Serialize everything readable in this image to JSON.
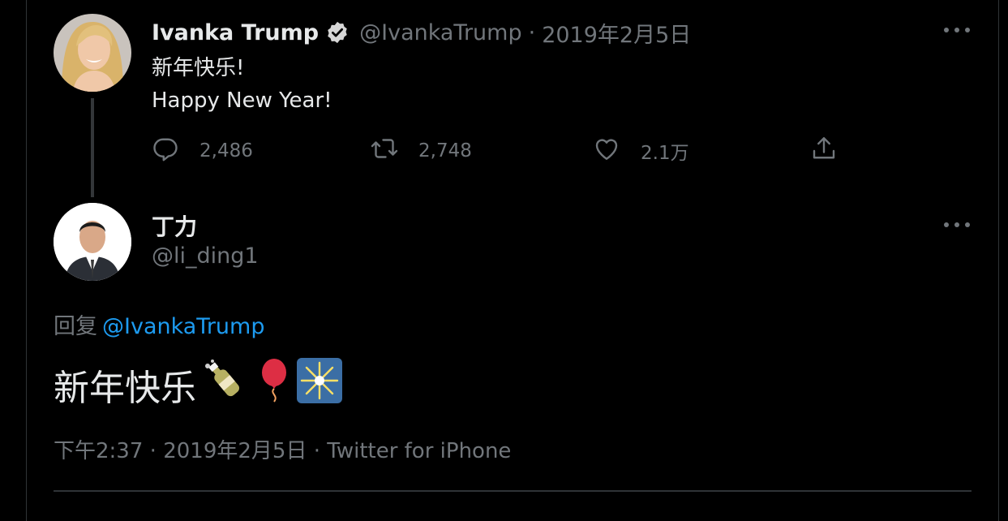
{
  "parent_tweet": {
    "author_name": "Ivanka Trump",
    "verified_icon": "verified-badge-icon",
    "handle": "@IvankaTrump",
    "separator": "·",
    "date": "2019年2月5日",
    "text": "新年快乐!\nHappy New Year!",
    "reply_count": "2,486",
    "retweet_count": "2,748",
    "like_count": "2.1万",
    "icons": [
      "reply-icon",
      "retweet-icon",
      "like-icon",
      "share-icon",
      "more-icon"
    ]
  },
  "reply_tweet": {
    "author_name": "丁力",
    "handle": "@li_ding1",
    "replying_prefix": "回复",
    "replying_to": "@IvankaTrump",
    "text": "新年快乐",
    "emojis": [
      "champagne-emoji",
      "balloon-emoji",
      "sparkler-emoji"
    ],
    "time": "下午2:37",
    "separator": "·",
    "date": "2019年2月5日",
    "source": "Twitter for iPhone"
  },
  "colors": {
    "background": "#000000",
    "primary_text": "#e7e9ea",
    "secondary_text": "#71767b",
    "link": "#1d9bf0",
    "divider": "#2f3336"
  }
}
